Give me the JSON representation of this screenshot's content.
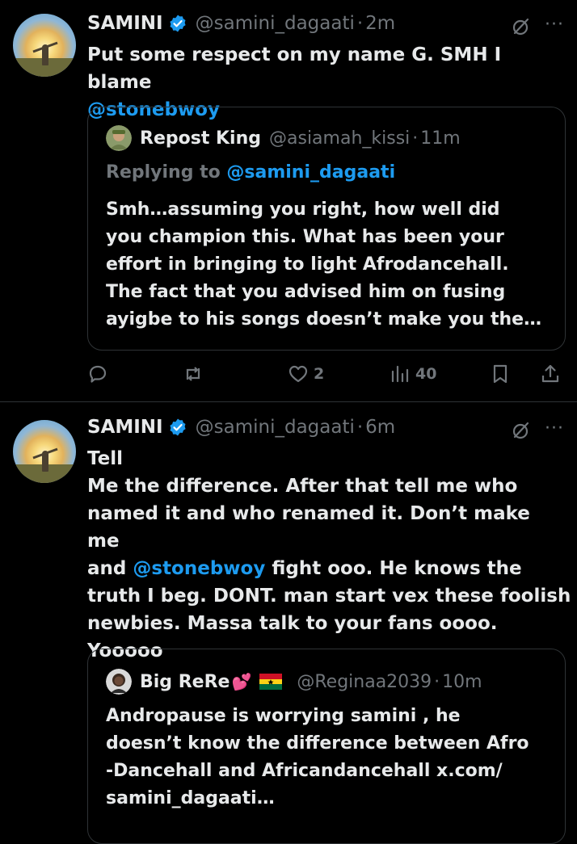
{
  "tweet1": {
    "name": "SAMINI",
    "handle": "@samini_dagaati",
    "dot": "·",
    "time": "2m",
    "more": "···",
    "text_pre": "Put some respect on my name G. SMH I blame",
    "mention": "@stonebwoy",
    "quote": {
      "name": "Repost King",
      "handle": "@asiamah_kissi",
      "dot": "·",
      "time": "11m",
      "replying_label": "Replying to",
      "replying_handle": "@samini_dagaati",
      "lines": [
        "Smh…assuming you right, how well did",
        "you champion this. What has been your",
        "effort in bringing to light Afrodancehall.",
        "The fact that you advised him on fusing",
        "ayigbe to his songs doesn’t make you the…"
      ]
    },
    "actions": {
      "replies": "",
      "reposts": "",
      "likes": "2",
      "views": "40"
    }
  },
  "tweet2": {
    "name": "SAMINI",
    "handle": "@samini_dagaati",
    "dot": "·",
    "time": "6m",
    "more": "···",
    "line1": "Tell",
    "line2": "Me the difference. After that tell me who",
    "line3": "named it and who renamed it. Don’t make me",
    "line4_pre": "and",
    "line4_mention": "@stonebwoy",
    "line4_post": "fight ooo. He knows the",
    "line5": "truth I beg. DONT. man start vex these foolish",
    "line6": "newbies. Massa talk to your fans oooo.",
    "line7": "Yooooo",
    "quote": {
      "name": "Big ReRe",
      "heart": "💕",
      "handle": "@Reginaa2039",
      "dot": "·",
      "time": "10m",
      "lines": [
        "Andropause is worrying samini  , he",
        "doesn’t know the difference between Afro",
        "-Dancehall and Africandancehall x.com/",
        "samini_dagaati…"
      ]
    }
  },
  "colors": {
    "background": "#000000",
    "text": "#e7e9ea",
    "muted": "#71767b",
    "link": "#1d9bf0",
    "border": "#2f3336"
  }
}
